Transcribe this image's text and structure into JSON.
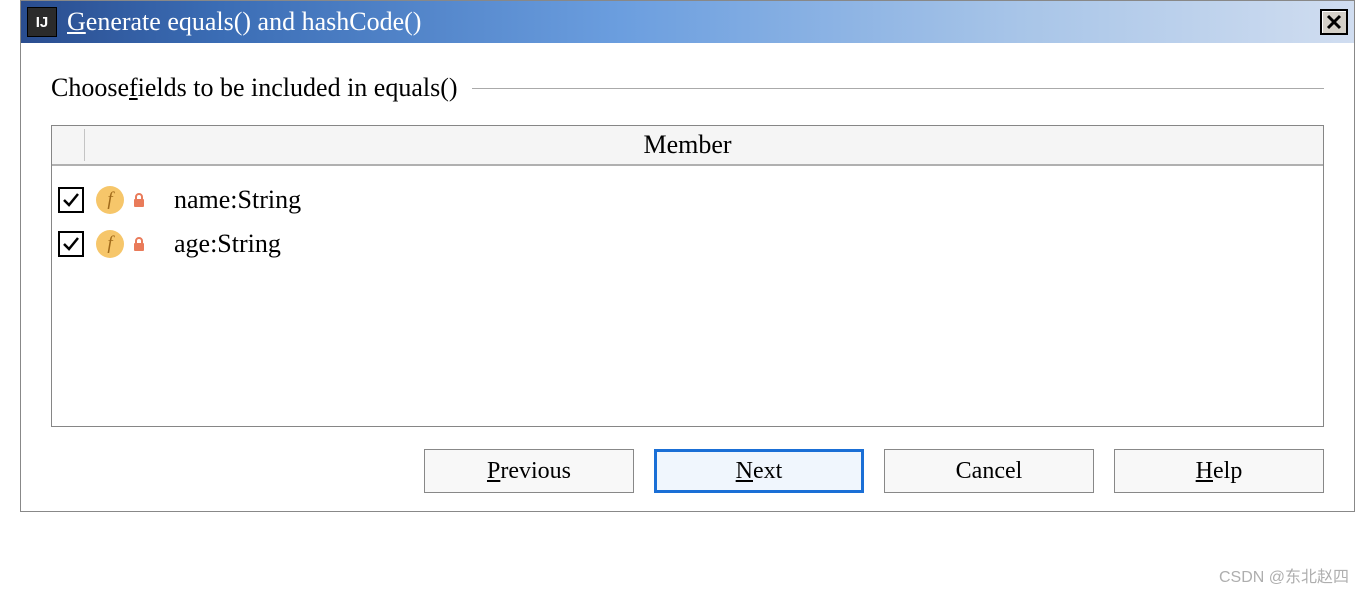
{
  "window": {
    "title": "Generate equals() and hashCode()",
    "app_icon_text": "IJ"
  },
  "group": {
    "label_prefix": "Choose ",
    "label_underlined": "f",
    "label_suffix": "ields to be included in equals()"
  },
  "table": {
    "header": "Member",
    "rows": [
      {
        "checked": true,
        "field_icon": "f",
        "label": "name:String"
      },
      {
        "checked": true,
        "field_icon": "f",
        "label": "age:String"
      }
    ]
  },
  "buttons": {
    "previous": {
      "underlined": "P",
      "rest": "revious"
    },
    "next": {
      "underlined": "N",
      "rest": "ext"
    },
    "cancel": {
      "text": "Cancel"
    },
    "help": {
      "underlined": "H",
      "rest": "elp"
    }
  },
  "watermark": "CSDN @东北赵四"
}
